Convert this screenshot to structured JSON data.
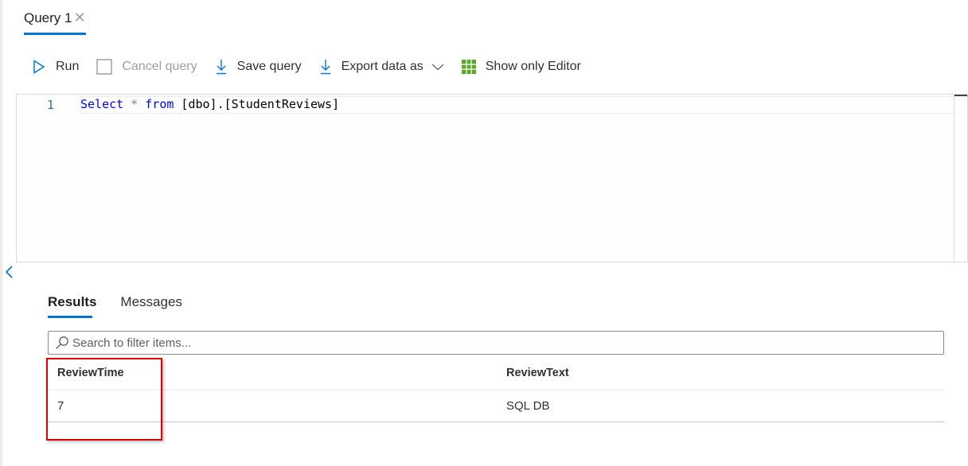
{
  "tab": {
    "label": "Query 1",
    "close_icon": "close-icon"
  },
  "toolbar": {
    "run": "Run",
    "cancel": "Cancel query",
    "save": "Save query",
    "export": "Export data as",
    "show_editor": "Show only Editor"
  },
  "editor": {
    "line_number": "1",
    "code": {
      "kw1": "Select",
      "star": " * ",
      "kw2": "from",
      "rest": " [dbo].[StudentReviews]"
    }
  },
  "results": {
    "tabs": [
      "Results",
      "Messages"
    ],
    "active_tab": "Results",
    "search_placeholder": "Search to filter items...",
    "columns": [
      "ReviewTime",
      "ReviewText"
    ],
    "rows": [
      [
        "7",
        "SQL DB"
      ]
    ]
  },
  "colors": {
    "accent": "#0078d4",
    "highlight": "#e00000",
    "grid_icon": "#5ea52b"
  }
}
